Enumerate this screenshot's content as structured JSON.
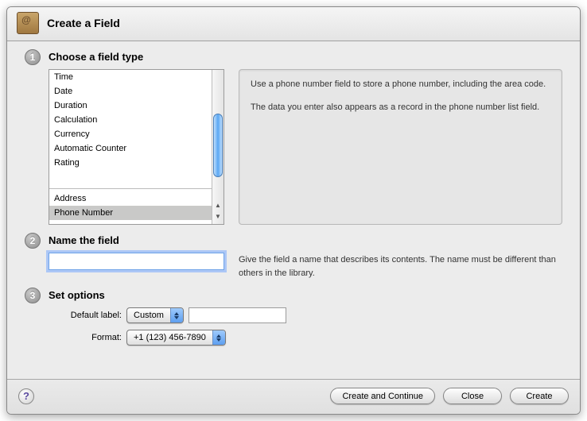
{
  "header": {
    "title": "Create a Field"
  },
  "step1": {
    "title": "Choose a field type",
    "items": [
      "Time",
      "Date",
      "Duration",
      "Calculation",
      "Currency",
      "Automatic Counter",
      "Rating"
    ],
    "items2": [
      "Address",
      "Phone Number"
    ],
    "selected": "Phone Number",
    "desc_line1": "Use a phone number field to store a phone number, including the area code.",
    "desc_line2": "The data you enter also appears as a record in the phone number list field."
  },
  "step2": {
    "title": "Name the field",
    "value": "",
    "hint": "Give the field a name that describes its contents. The name must be different than others in the library."
  },
  "step3": {
    "title": "Set options",
    "default_label_label": "Default label:",
    "default_label_value": "Custom",
    "label_input_value": "",
    "format_label": "Format:",
    "format_value": "+1 (123) 456-7890"
  },
  "footer": {
    "help": "?",
    "create_continue": "Create and Continue",
    "close": "Close",
    "create": "Create"
  }
}
